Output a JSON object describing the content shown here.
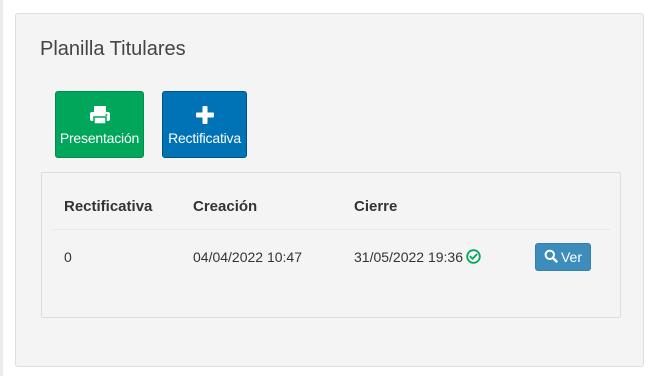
{
  "panel": {
    "title": "Planilla Titulares"
  },
  "toolbar": {
    "presentacion_label": "Presentación",
    "presentacion_icon": "print-icon",
    "rectificativa_label": "Rectificativa",
    "rectificativa_icon": "plus-icon"
  },
  "table": {
    "headers": [
      "Rectificativa",
      "Creación",
      "Cierre"
    ],
    "rows": [
      {
        "rectificativa": "0",
        "creacion": "04/04/2022 10:47",
        "cierre": "31/05/2022 19:36",
        "status_icon": "check-circle-icon",
        "action_label": "Ver",
        "action_icon": "search-icon"
      }
    ]
  },
  "colors": {
    "green": "#00a65a",
    "blue": "#0073b7",
    "ver_button": "#3c8dbc",
    "check": "#00a65a"
  }
}
